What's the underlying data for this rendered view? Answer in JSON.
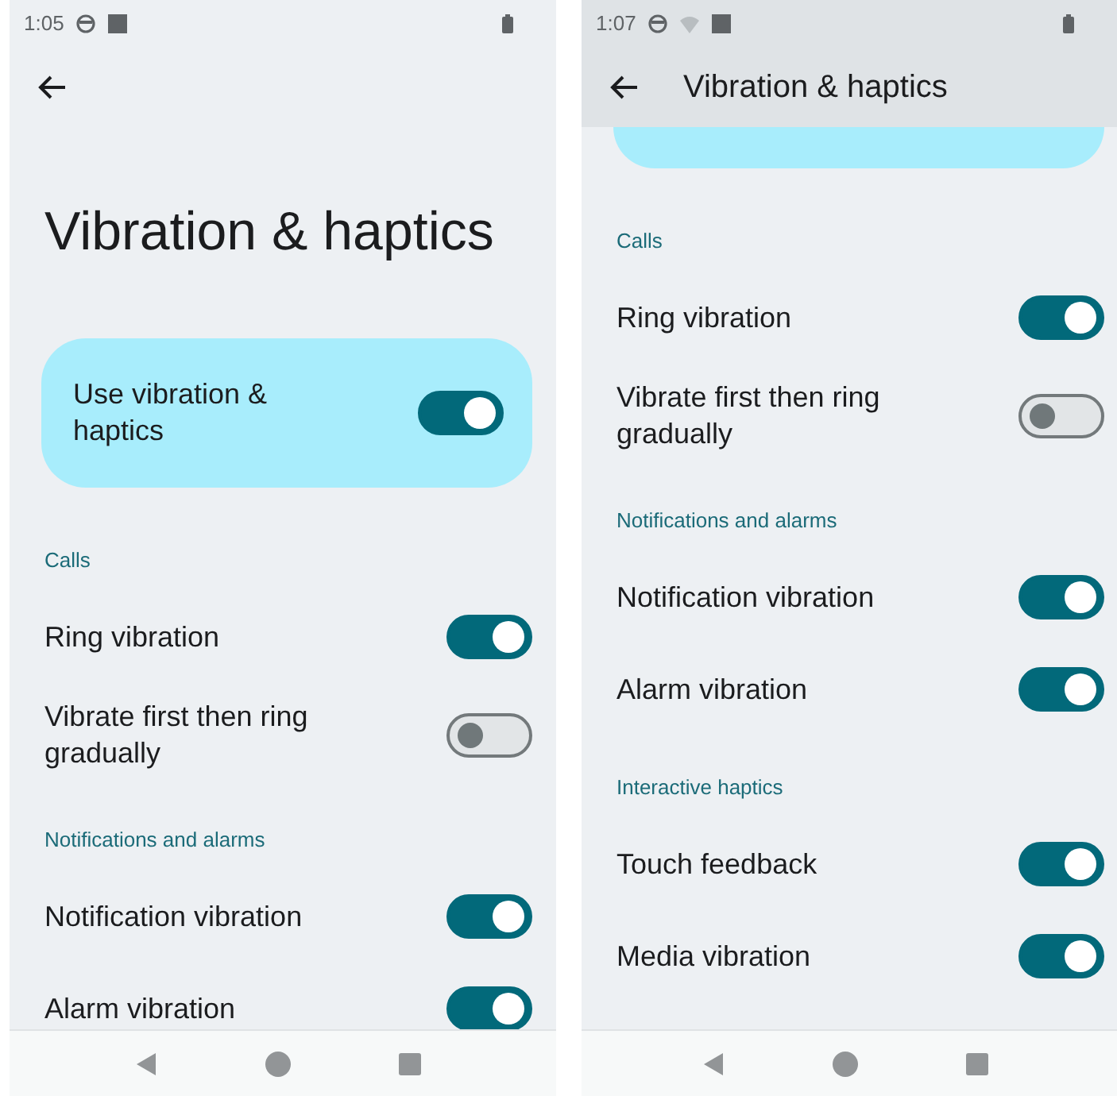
{
  "screens": [
    {
      "status_bar": {
        "time": "1:05",
        "wifi_icon": false
      },
      "app_bar": {
        "raised": false
      },
      "items": [
        {
          "kind": "page_title",
          "text": "Vibration & haptics"
        },
        {
          "kind": "main_switch",
          "label": "Use vibration & haptics",
          "on": true
        },
        {
          "kind": "section",
          "text": "Calls"
        },
        {
          "kind": "switch",
          "label": "Ring vibration",
          "on": true
        },
        {
          "kind": "switch",
          "label": "Vibrate first then ring gradually",
          "on": false
        },
        {
          "kind": "section",
          "text": "Notifications and alarms"
        },
        {
          "kind": "switch",
          "label": "Notification vibration",
          "on": true
        },
        {
          "kind": "switch",
          "label": "Alarm vibration",
          "on": true
        }
      ]
    },
    {
      "status_bar": {
        "time": "1:07",
        "wifi_icon": true
      },
      "app_bar": {
        "raised": true,
        "title": "Vibration & haptics"
      },
      "items": [
        {
          "kind": "card_edge"
        },
        {
          "kind": "section",
          "text": "Calls"
        },
        {
          "kind": "switch",
          "label": "Ring vibration",
          "on": true
        },
        {
          "kind": "switch",
          "label": "Vibrate first then ring gradually",
          "on": false
        },
        {
          "kind": "section",
          "text": "Notifications and alarms"
        },
        {
          "kind": "switch",
          "label": "Notification vibration",
          "on": true
        },
        {
          "kind": "switch",
          "label": "Alarm vibration",
          "on": true
        },
        {
          "kind": "section",
          "text": "Interactive haptics"
        },
        {
          "kind": "switch",
          "label": "Touch feedback",
          "on": true
        },
        {
          "kind": "switch",
          "label": "Media vibration",
          "on": true
        }
      ]
    }
  ]
}
